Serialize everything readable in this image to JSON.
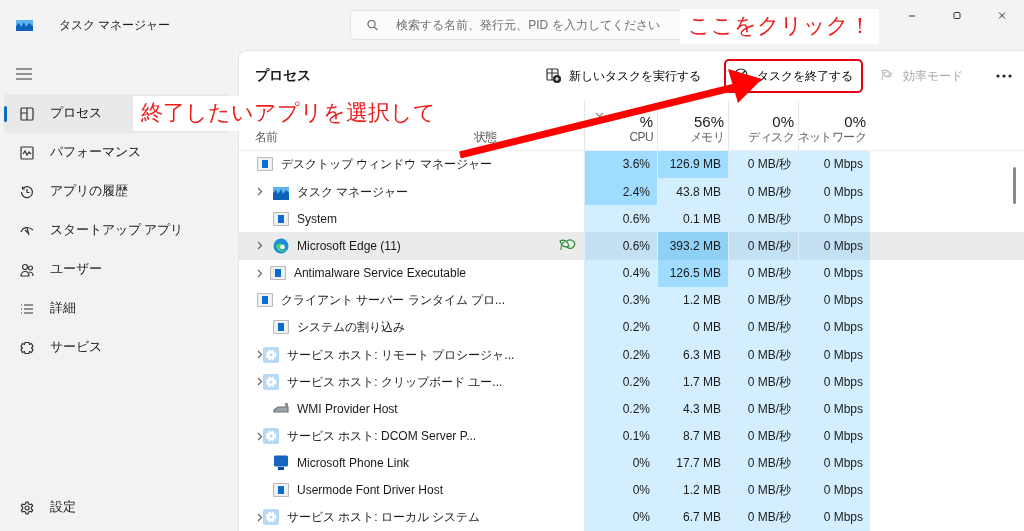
{
  "window": {
    "title": "タスク マネージャー"
  },
  "search": {
    "placeholder": "検索する名前、発行元、PID を入力してください"
  },
  "sidebar": {
    "items": [
      {
        "label": "プロセス",
        "selected": true
      },
      {
        "label": "パフォーマンス",
        "selected": false
      },
      {
        "label": "アプリの履歴",
        "selected": false
      },
      {
        "label": "スタートアップ アプリ",
        "selected": false
      },
      {
        "label": "ユーザー",
        "selected": false
      },
      {
        "label": "詳細",
        "selected": false
      },
      {
        "label": "サービス",
        "selected": false
      }
    ],
    "footer": {
      "label": "設定",
      "selected": false
    }
  },
  "page": {
    "title": "プロセス"
  },
  "toolbar": [
    {
      "kind": "button",
      "label": "新しいタスクを実行する",
      "disabled": false,
      "annotated": false
    },
    {
      "kind": "button",
      "label": "タスクを終了する",
      "disabled": false,
      "annotated": true
    },
    {
      "kind": "button",
      "label": "効率モード",
      "disabled": true,
      "annotated": false
    },
    {
      "kind": "more"
    }
  ],
  "table": {
    "columns": [
      {
        "label": "名前"
      },
      {
        "label": "状態"
      },
      {
        "total": "%",
        "label": "CPU",
        "sorted": true
      },
      {
        "total": "56%",
        "label": "メモリ",
        "sorted": false
      },
      {
        "total": "0%",
        "label": "ディスク",
        "sorted": false
      },
      {
        "total": "0%",
        "label": "ネットワーク",
        "sorted": false
      }
    ],
    "rows": [
      {
        "name": "デスクトップ ウィンドウ マネージャー",
        "expandable": false,
        "efficiency": false,
        "hovered": false,
        "cpu": "3.6%",
        "cpu_high": true,
        "memory": "126.9 MB",
        "memory_high": true,
        "disk": "0 MB/秒",
        "network": "0 Mbps"
      },
      {
        "name": "タスク マネージャー",
        "expandable": true,
        "efficiency": false,
        "hovered": false,
        "cpu": "2.4%",
        "cpu_high": true,
        "memory": "43.8 MB",
        "memory_high": false,
        "disk": "0 MB/秒",
        "network": "0 Mbps"
      },
      {
        "name": "System",
        "expandable": false,
        "efficiency": false,
        "hovered": false,
        "cpu": "0.6%",
        "cpu_high": false,
        "memory": "0.1 MB",
        "memory_high": false,
        "disk": "0 MB/秒",
        "network": "0 Mbps"
      },
      {
        "name": "Microsoft Edge (11)",
        "expandable": true,
        "efficiency": true,
        "hovered": true,
        "cpu": "0.6%",
        "cpu_high": false,
        "memory": "393.2 MB",
        "memory_high": true,
        "disk": "0 MB/秒",
        "network": "0 Mbps"
      },
      {
        "name": "Antimalware Service Executable",
        "expandable": true,
        "efficiency": false,
        "hovered": false,
        "cpu": "0.4%",
        "cpu_high": false,
        "memory": "126.5 MB",
        "memory_high": true,
        "disk": "0 MB/秒",
        "network": "0 Mbps"
      },
      {
        "name": "クライアント サーバー ランタイム プロ...",
        "expandable": false,
        "efficiency": false,
        "hovered": false,
        "cpu": "0.3%",
        "cpu_high": false,
        "memory": "1.2 MB",
        "memory_high": false,
        "disk": "0 MB/秒",
        "network": "0 Mbps"
      },
      {
        "name": "システムの割り込み",
        "expandable": false,
        "efficiency": false,
        "hovered": false,
        "cpu": "0.2%",
        "cpu_high": false,
        "memory": "0 MB",
        "memory_high": false,
        "disk": "0 MB/秒",
        "network": "0 Mbps"
      },
      {
        "name": "サービス ホスト: リモート プロシージャ...",
        "expandable": true,
        "efficiency": false,
        "hovered": false,
        "cpu": "0.2%",
        "cpu_high": false,
        "memory": "6.3 MB",
        "memory_high": false,
        "disk": "0 MB/秒",
        "network": "0 Mbps"
      },
      {
        "name": "サービス ホスト: クリップボード ユー...",
        "expandable": true,
        "efficiency": false,
        "hovered": false,
        "cpu": "0.2%",
        "cpu_high": false,
        "memory": "1.7 MB",
        "memory_high": false,
        "disk": "0 MB/秒",
        "network": "0 Mbps"
      },
      {
        "name": "WMI Provider Host",
        "expandable": false,
        "efficiency": false,
        "hovered": false,
        "cpu": "0.2%",
        "cpu_high": false,
        "memory": "4.3 MB",
        "memory_high": false,
        "disk": "0 MB/秒",
        "network": "0 Mbps"
      },
      {
        "name": "サービス ホスト: DCOM Server P...",
        "expandable": true,
        "efficiency": false,
        "hovered": false,
        "cpu": "0.1%",
        "cpu_high": false,
        "memory": "8.7 MB",
        "memory_high": false,
        "disk": "0 MB/秒",
        "network": "0 Mbps"
      },
      {
        "name": "Microsoft Phone Link",
        "expandable": false,
        "efficiency": false,
        "hovered": false,
        "cpu": "0%",
        "cpu_high": false,
        "memory": "17.7 MB",
        "memory_high": false,
        "disk": "0 MB/秒",
        "network": "0 Mbps"
      },
      {
        "name": "Usermode Font Driver Host",
        "expandable": false,
        "efficiency": false,
        "hovered": false,
        "cpu": "0%",
        "cpu_high": false,
        "memory": "1.2 MB",
        "memory_high": false,
        "disk": "0 MB/秒",
        "network": "0 Mbps"
      },
      {
        "name": "サービス ホスト: ローカル システム",
        "expandable": true,
        "efficiency": false,
        "hovered": false,
        "cpu": "0%",
        "cpu_high": false,
        "memory": "6.7 MB",
        "memory_high": false,
        "disk": "0 MB/秒",
        "network": "0 Mbps"
      }
    ]
  },
  "annotations": [
    {
      "kind": "callout",
      "text": "終了したいアプリを選択して"
    },
    {
      "kind": "callout",
      "text": "ここをクリック！"
    },
    {
      "kind": "arrow"
    }
  ]
}
